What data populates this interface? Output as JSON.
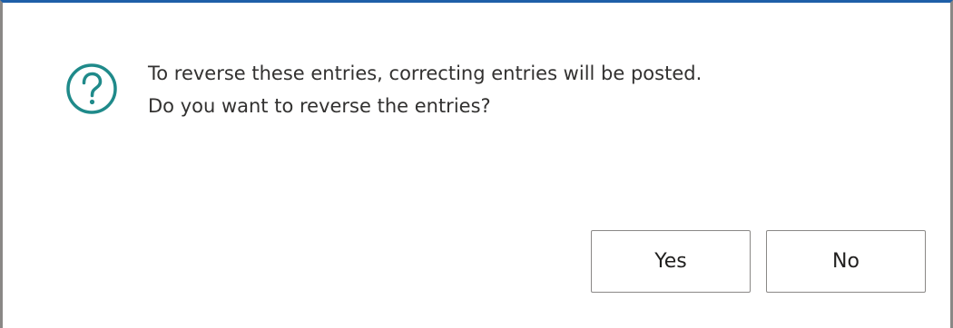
{
  "dialog": {
    "icon": "question-circle-icon",
    "message_line1": "To reverse these entries, correcting entries will be posted.",
    "message_line2": "Do you want to reverse the entries?",
    "buttons": {
      "yes_label": "Yes",
      "no_label": "No"
    }
  },
  "colors": {
    "icon_teal": "#1f8a8a",
    "text": "#323130",
    "button_border": "#8a8886",
    "top_accent": "#1e5fa8"
  }
}
